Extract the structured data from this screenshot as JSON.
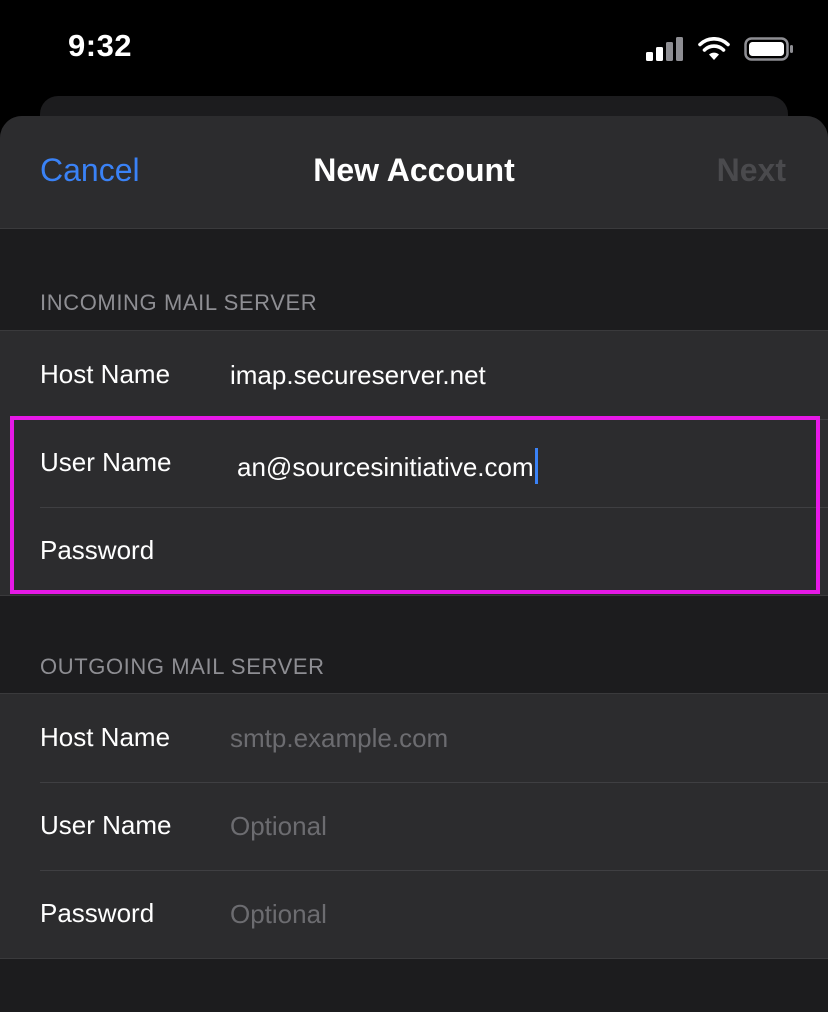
{
  "status_bar": {
    "time": "9:32",
    "icons": [
      "signal-icon",
      "wifi-icon",
      "battery-icon"
    ]
  },
  "nav": {
    "cancel_label": "Cancel",
    "title": "New Account",
    "next_label": "Next"
  },
  "incoming": {
    "header": "INCOMING MAIL SERVER",
    "host": {
      "label": "Host Name",
      "value": "imap.secureserver.net"
    },
    "user": {
      "label": "User Name",
      "value": "an@sourcesinitiative.com"
    },
    "password": {
      "label": "Password",
      "value": ""
    }
  },
  "outgoing": {
    "header": "OUTGOING MAIL SERVER",
    "host": {
      "label": "Host Name",
      "placeholder": "smtp.example.com"
    },
    "user": {
      "label": "User Name",
      "placeholder": "Optional"
    },
    "password": {
      "label": "Password",
      "placeholder": "Optional"
    }
  },
  "colors": {
    "accent": "#3a82f6",
    "highlight": "#e619e6",
    "disabled": "#4a4a4d"
  }
}
